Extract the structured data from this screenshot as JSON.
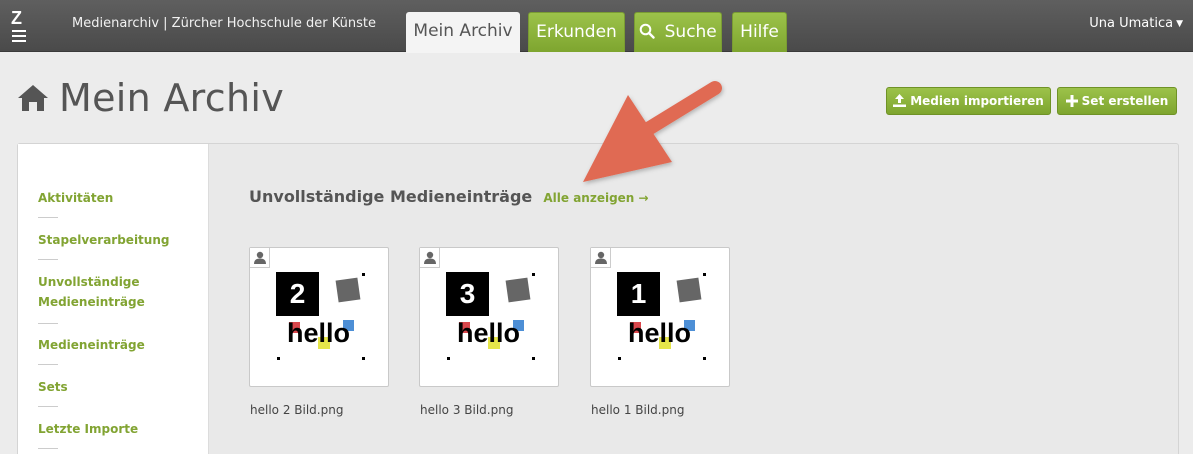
{
  "header": {
    "site_title": "Medienarchiv | Zürcher Hochschule der Künste",
    "logo_letter": "Z",
    "tabs": [
      {
        "label": "Mein Archiv",
        "active": true
      },
      {
        "label": "Erkunden",
        "active": false
      },
      {
        "label": "Suche",
        "active": false
      },
      {
        "label": "Hilfe",
        "active": false
      }
    ],
    "user_name": "Una Umatica",
    "accent_color": "#8ab23b"
  },
  "page": {
    "title": "Mein Archiv",
    "actions": {
      "import_label": "Medien importieren",
      "create_set_label": "Set erstellen"
    }
  },
  "sidebar": {
    "items": [
      {
        "label": "Aktivitäten"
      },
      {
        "label": "Stapelverarbeitung"
      },
      {
        "label": "Unvollständige Medieneinträge"
      },
      {
        "label": "Medieneinträge"
      },
      {
        "label": "Sets"
      },
      {
        "label": "Letzte Importe"
      }
    ]
  },
  "main": {
    "section_title": "Unvollständige Medieneinträge",
    "show_all_label": "Alle anzeigen →",
    "entries": [
      {
        "number": "2",
        "thumb_text": "hello",
        "filename": "hello 2 Bild.png"
      },
      {
        "number": "3",
        "thumb_text": "hello",
        "filename": "hello 3 Bild.png"
      },
      {
        "number": "1",
        "thumb_text": "hello",
        "filename": "hello 1 Bild.png"
      }
    ]
  },
  "annotation": {
    "arrow_color": "#e06a52"
  }
}
